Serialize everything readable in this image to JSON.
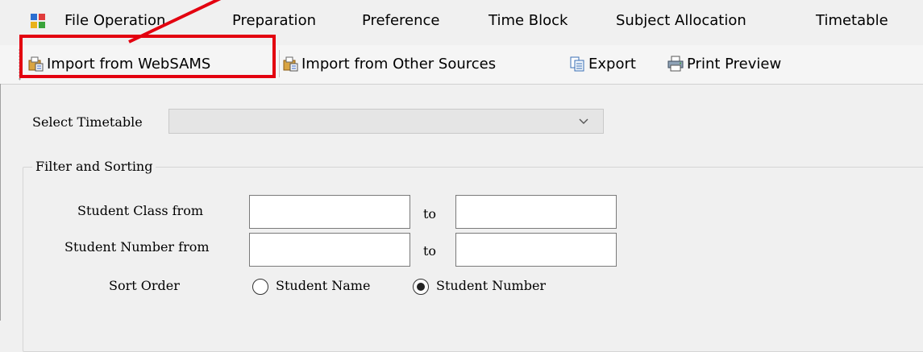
{
  "menu": {
    "items": [
      {
        "label": "File Operation"
      },
      {
        "label": "Preparation"
      },
      {
        "label": "Preference"
      },
      {
        "label": "Time Block"
      },
      {
        "label": "Subject Allocation"
      },
      {
        "label": "Timetable"
      }
    ]
  },
  "toolbar": {
    "import_websams": "Import from WebSAMS",
    "import_other": "Import from Other Sources",
    "export": "Export",
    "print_preview": "Print Preview"
  },
  "form": {
    "select_timetable_label": "Select Timetable",
    "select_timetable_value": "",
    "filter_group_title": "Filter and Sorting",
    "student_class_from_label": "Student Class from",
    "student_number_from_label": "Student Number from",
    "to_label": "to",
    "sort_order_label": "Sort Order",
    "sort_options": [
      {
        "label": "Student Name",
        "selected": false
      },
      {
        "label": "Student Number",
        "selected": true
      }
    ],
    "student_class_from_value": "",
    "student_class_to_value": "",
    "student_number_from_value": "",
    "student_number_to_value": ""
  },
  "annotation": {
    "highlight_color": "#e3000f"
  }
}
